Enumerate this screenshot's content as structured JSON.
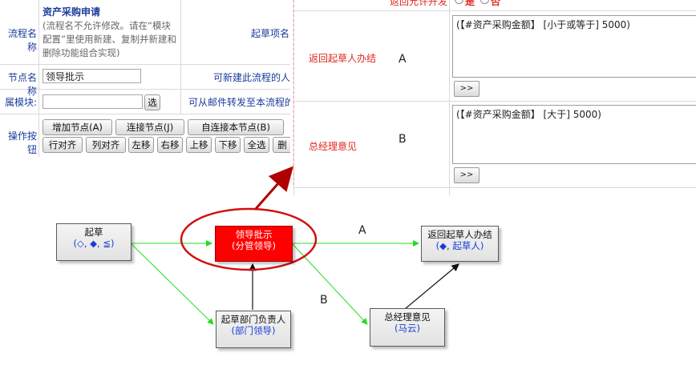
{
  "form": {
    "flow_name_label": "流程名称",
    "flow_name_value": "资产采购申请",
    "flow_name_hint_lines": [
      "(流程名不允许修改。请在“模块",
      "配置”里使用新建、复制并新建和",
      "删除功能组合实现)"
    ],
    "right_col_1": "起草项名",
    "node_name_label": "节点名称",
    "node_name_value": "领导批示",
    "right_col_2": "可新建此流程的人",
    "module_label": "属模块:",
    "module_value": "",
    "select_button": "选",
    "right_col_3": "可从邮件转发至本流程的",
    "ops_label": "操作按钮",
    "buttons_row1": [
      "增加节点(A)",
      "连接节点(J)",
      "自连接本节点(B)"
    ],
    "buttons_row2": [
      "行对齐",
      "列对齐",
      "左移",
      "右移",
      "上移",
      "下移",
      "全选",
      "删"
    ]
  },
  "conditions": {
    "top_cut_text": "返回允许开发",
    "top_cut_options": [
      "是",
      "否"
    ],
    "items": [
      {
        "label": "返回起草人办结",
        "letter": "A",
        "expression": "(【#资产采购金额】 [小于或等于] 5000)",
        "button": ">>"
      },
      {
        "label": "总经理意见",
        "letter": "B",
        "expression": "(【#资产采购金额】 [大于] 5000)",
        "button": ">>"
      }
    ]
  },
  "diagram": {
    "nodes": [
      {
        "id": "draft",
        "title": "起草",
        "sub": "(◇, ◆, ≦)"
      },
      {
        "id": "leader",
        "title": "领导批示",
        "sub": "(分管领导)"
      },
      {
        "id": "return",
        "title": "返回起草人办结",
        "sub": "(◆, 起草人)"
      },
      {
        "id": "dept",
        "title": "起草部门负责人",
        "sub": "(部门领导)"
      },
      {
        "id": "gm",
        "title": "总经理意见",
        "sub": "(马云)"
      }
    ],
    "edge_labels": [
      "A",
      "B"
    ]
  },
  "colors": {
    "label_blue": "#1a3d9c",
    "highlight_red": "#ff0000",
    "condition_red": "#e0281e",
    "edge_green": "#22dd22"
  }
}
